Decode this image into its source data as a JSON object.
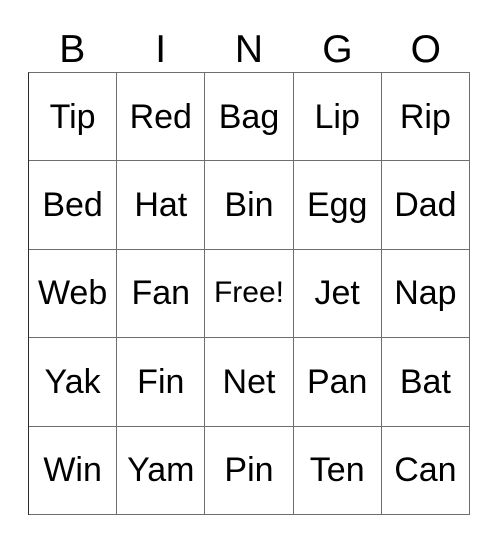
{
  "card": {
    "title": "BINGO",
    "background_color": "#ffffff",
    "text_color": "#000000",
    "grid_line_color": "#6e6e6e"
  },
  "header": {
    "letters": [
      "B",
      "I",
      "N",
      "G",
      "O"
    ]
  },
  "grid": {
    "columns": 5,
    "rows": 5,
    "free_space": {
      "row": 2,
      "column": 2,
      "label": "Free!"
    },
    "cells": [
      [
        "Tip",
        "Red",
        "Bag",
        "Lip",
        "Rip"
      ],
      [
        "Bed",
        "Hat",
        "Bin",
        "Egg",
        "Dad"
      ],
      [
        "Web",
        "Fan",
        "Free!",
        "Jet",
        "Nap"
      ],
      [
        "Yak",
        "Fin",
        "Net",
        "Pan",
        "Bat"
      ],
      [
        "Win",
        "Yam",
        "Pin",
        "Ten",
        "Can"
      ]
    ]
  }
}
